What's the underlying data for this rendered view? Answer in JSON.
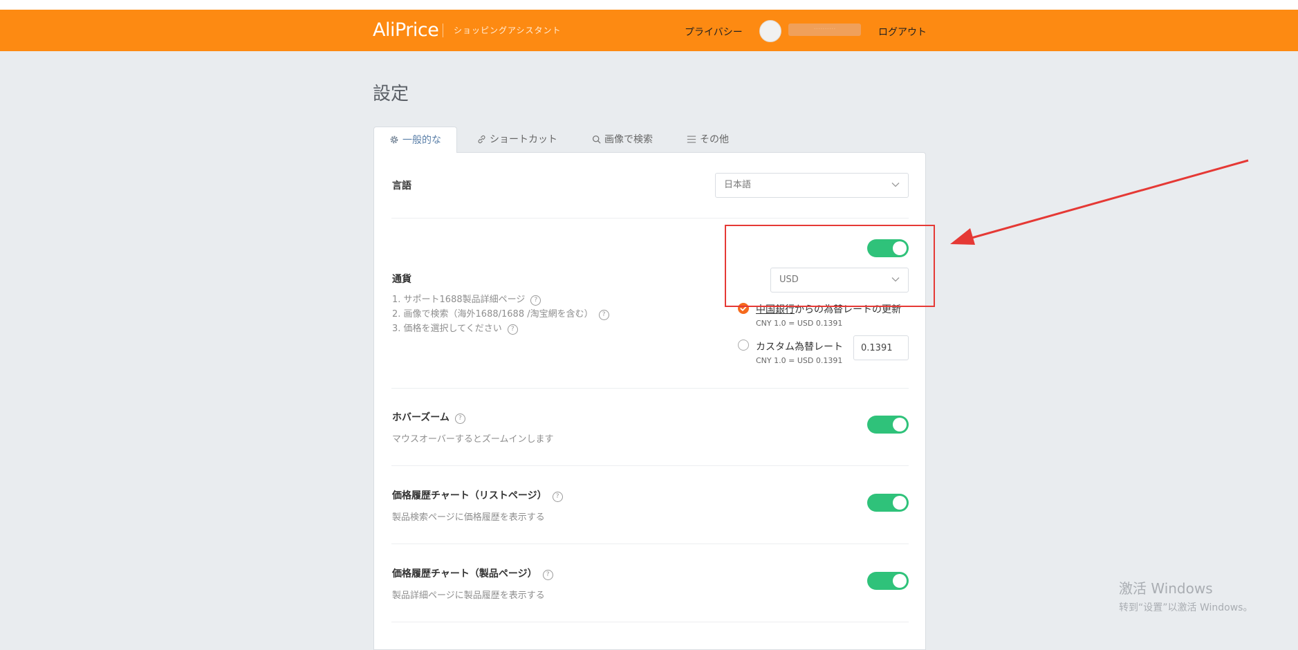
{
  "header": {
    "logo": "AliPrice",
    "tagline": "ショッピングアシスタント",
    "privacy": "プライバシー",
    "username": "··········",
    "logout": "ログアウト"
  },
  "page": {
    "title": "設定"
  },
  "tabs": [
    {
      "label": "一般的な",
      "icon": "gear-icon"
    },
    {
      "label": "ショートカット",
      "icon": "link-icon"
    },
    {
      "label": "画像で検索",
      "icon": "search-icon"
    },
    {
      "label": "その他",
      "icon": "menu-icon"
    }
  ],
  "settings": {
    "language": {
      "label": "言語",
      "value": "日本語"
    },
    "currency": {
      "label": "通貨",
      "notes": [
        "1. サポート1688製品詳細ページ",
        "2. 画像で検索（海外1688/1688 /淘宝網を含む）",
        "3. 価格を選択してください"
      ],
      "enabled": true,
      "value": "USD",
      "options": [
        {
          "link": "中国銀行",
          "text": "からの為替レートの更新",
          "sub": "CNY 1.0 = USD 0.1391",
          "selected": true
        },
        {
          "text": "カスタム為替レート",
          "sub": "CNY 1.0 = USD 0.1391",
          "selected": false,
          "input_value": "0.1391"
        }
      ]
    },
    "hover_zoom": {
      "label": "ホバーズーム",
      "desc": "マウスオーバーするとズームインします",
      "enabled": true
    },
    "history_list": {
      "label": "価格履歴チャート（リストページ）",
      "desc": "製品検索ページに価格履歴を表示する",
      "enabled": true
    },
    "history_product": {
      "label": "価格履歴チャート（製品ページ）",
      "desc": "製品詳細ページに製品履歴を表示する",
      "enabled": true
    }
  },
  "annotation": {
    "box_color": "#e53935",
    "arrow_color": "#e53935"
  },
  "watermark": {
    "line1": "激活 Windows",
    "line2": "转到“设置”以激活 Windows。"
  },
  "colors": {
    "header": "#fd8a12",
    "toggle_on": "#2fc27a",
    "radio_on": "#f56a1d"
  }
}
